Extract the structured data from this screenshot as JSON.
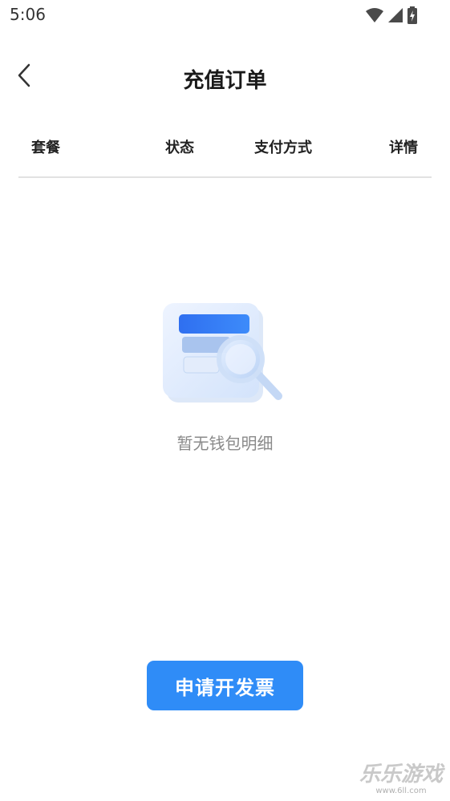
{
  "status_bar": {
    "time": "5:06",
    "icons": [
      "wifi-icon",
      "cell-signal-icon",
      "battery-charging-icon"
    ]
  },
  "nav": {
    "back_icon": "chevron-left-icon",
    "title": "充值订单"
  },
  "table": {
    "columns": [
      "套餐",
      "状态",
      "支付方式",
      "详情"
    ]
  },
  "empty_state": {
    "icon": "document-search-icon",
    "message": "暂无钱包明细"
  },
  "actions": {
    "invoice_label": "申请开发票"
  },
  "watermark": {
    "main": "乐乐游戏",
    "sub": "www.6ll.com"
  },
  "colors": {
    "accent": "#2f8cf7",
    "background": "#ffffff",
    "divider": "#e2e2e2",
    "muted_text": "#8a8a8a"
  }
}
